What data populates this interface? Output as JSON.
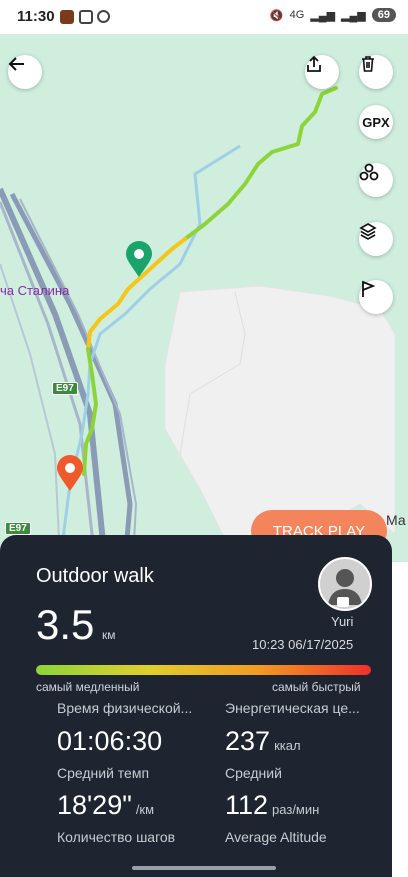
{
  "status_bar": {
    "time": "11:30",
    "network": "4G",
    "battery": "69"
  },
  "map": {
    "place_label": "ча Сталина",
    "road_label_1": "E97",
    "road_label_2": "E97",
    "edge_label": "Ма",
    "track_play_label": "TRACK PLAY",
    "gpx_label": "GPX",
    "track_colors": {
      "slow": "#8dd43a",
      "mid": "#f5c518",
      "fast": "#f0302a"
    },
    "start_marker_color": "#1aa36b",
    "end_marker_color": "#ef5a2c"
  },
  "workout": {
    "title": "Outdoor walk",
    "distance": "3.5",
    "distance_unit": "км",
    "user": "Yuri",
    "datetime": "10:23 06/17/2025",
    "legend_slow": "самый медленный",
    "legend_fast": "самый быстрый",
    "stats": {
      "duration_label": "Время физической...",
      "duration_value": "01:06:30",
      "energy_label": "Энергетическая це...",
      "energy_value": "237",
      "energy_unit": "ккал",
      "pace_label": "Средний темп",
      "pace_value": "18'29\"",
      "pace_unit": "/км",
      "cadence_label": "Средний",
      "cadence_value": "112",
      "cadence_unit": "раз/мин",
      "steps_label": "Количество шагов",
      "altitude_label": "Average Altitude"
    }
  }
}
